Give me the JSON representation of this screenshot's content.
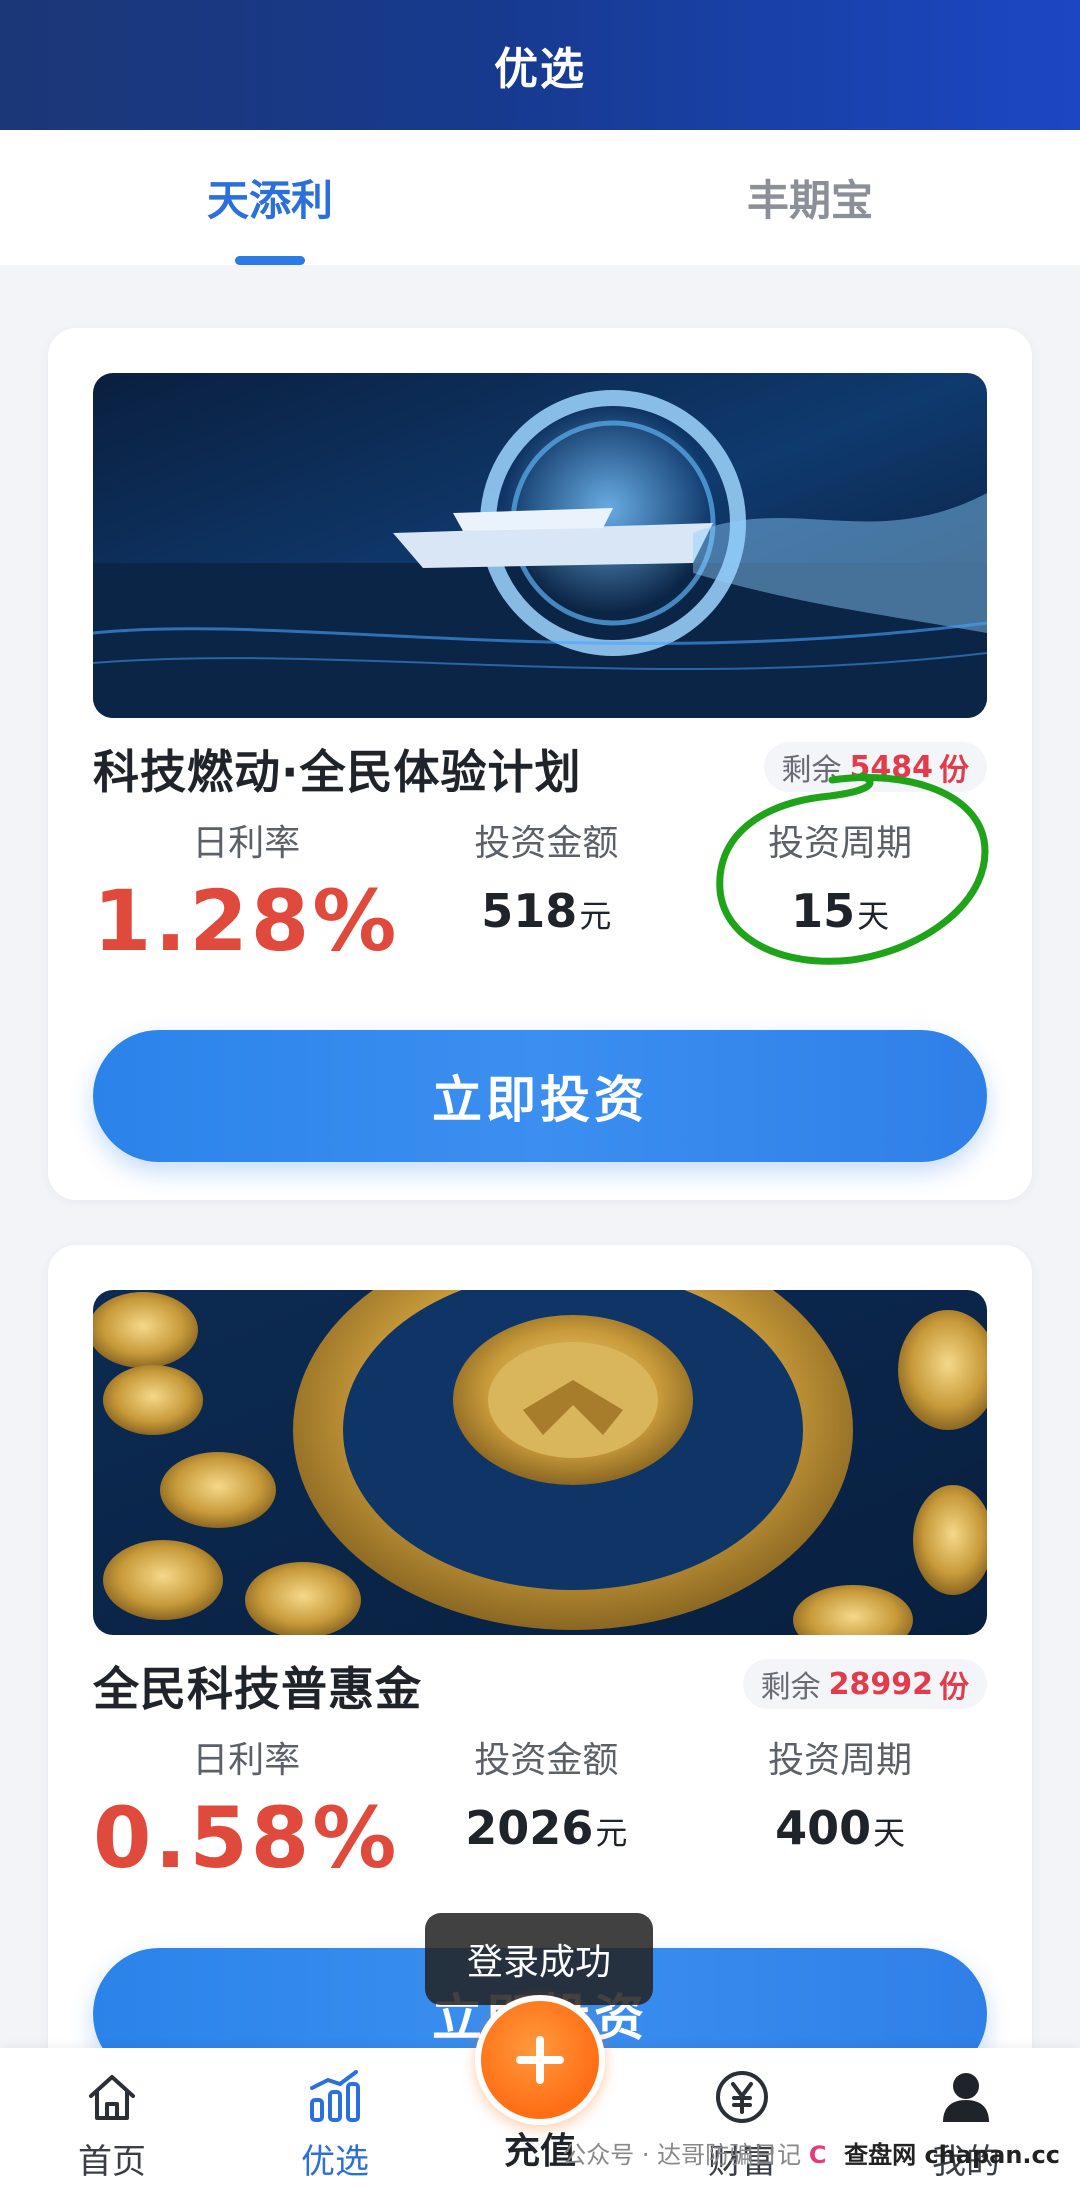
{
  "header": {
    "title": "优选"
  },
  "tabs": [
    {
      "label": "天添利",
      "active": true
    },
    {
      "label": "丰期宝",
      "active": false
    }
  ],
  "products": [
    {
      "name": "科技燃动·全民体验计划",
      "remain_label": "剩余",
      "remain_count": "5484",
      "remain_unit": "份",
      "rate_label": "日利率",
      "rate": "1.28%",
      "amount_label": "投资金额",
      "amount": "518",
      "amount_unit": "元",
      "period_label": "投资周期",
      "period": "15",
      "period_unit": "天",
      "button_label": "立即投资"
    },
    {
      "name": "全民科技普惠金",
      "remain_label": "剩余",
      "remain_count": "28992",
      "remain_unit": "份",
      "rate_label": "日利率",
      "rate": "0.58%",
      "amount_label": "投资金额",
      "amount": "2026",
      "amount_unit": "元",
      "period_label": "投资周期",
      "period": "400",
      "period_unit": "天",
      "button_label": "立即投资"
    }
  ],
  "toast": {
    "message": "登录成功"
  },
  "bottom_nav": [
    {
      "label": "首页",
      "icon": "home-icon",
      "active": false
    },
    {
      "label": "优选",
      "icon": "chart-icon",
      "active": true
    },
    {
      "label": "充值",
      "icon": "plus-icon",
      "active": false
    },
    {
      "label": "财富",
      "icon": "yen-icon",
      "active": false
    },
    {
      "label": "我的",
      "icon": "user-icon",
      "active": false
    }
  ],
  "watermark": {
    "text": "公众号 · 达哥防骗日记",
    "logo": "C",
    "site": "查盘网 chapan.cc"
  },
  "colors": {
    "accent": "#2a7be6",
    "rate": "#e04a3c",
    "remain": "#e23b4c",
    "recharge": "#ff6d14"
  }
}
